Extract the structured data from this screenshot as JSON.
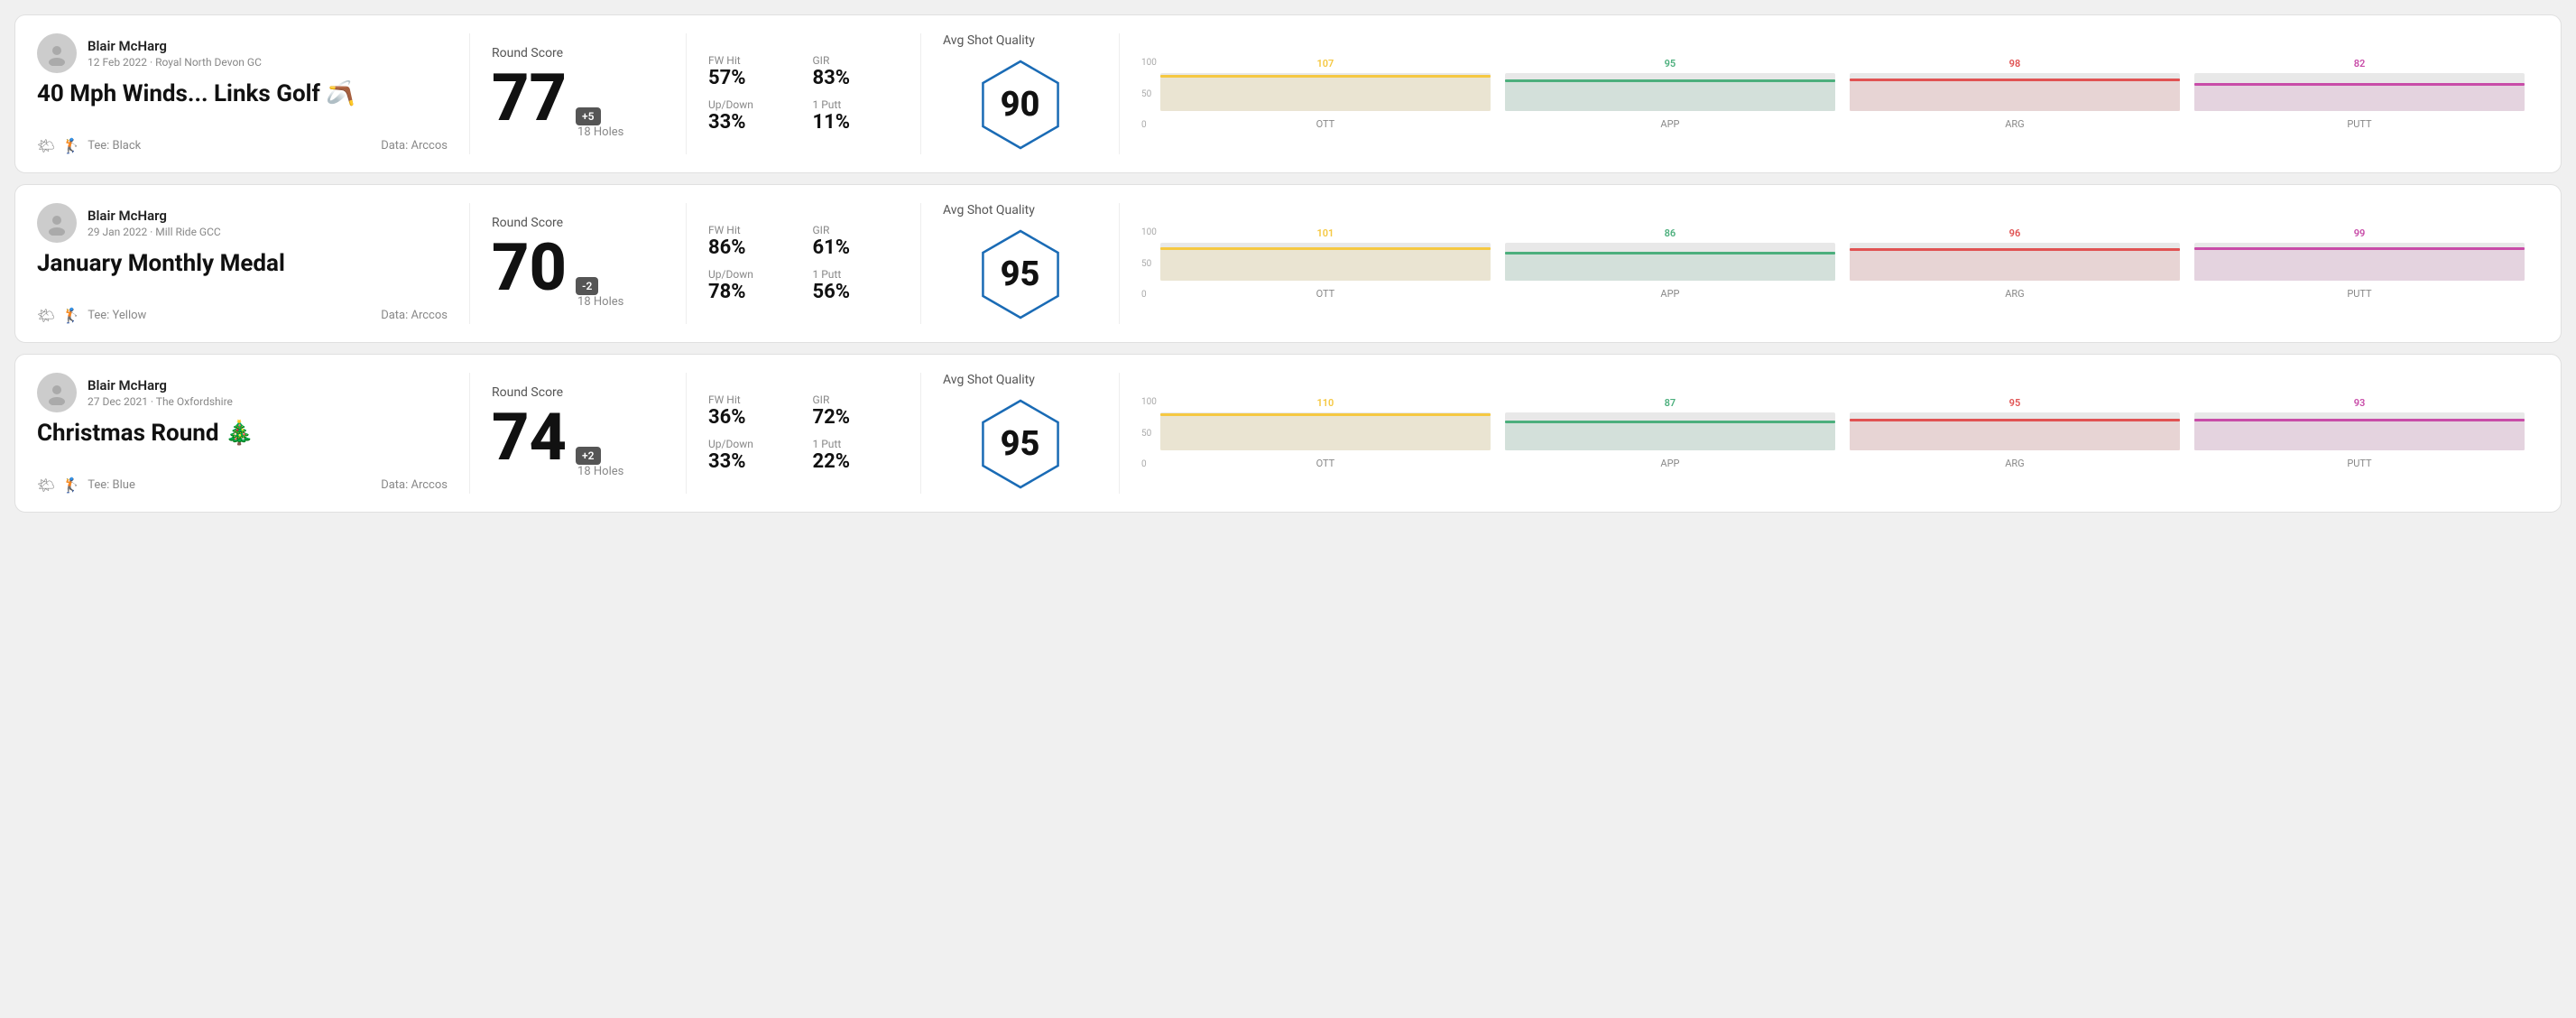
{
  "rounds": [
    {
      "id": "round1",
      "user": {
        "name": "Blair McHarg",
        "date": "12 Feb 2022",
        "course": "Royal North Devon GC"
      },
      "title": "40 Mph Winds... Links Golf 🪃",
      "tee": "Black",
      "data_source": "Arccos",
      "round_score_label": "Round Score",
      "score": "77",
      "score_diff": "+5",
      "holes": "18 Holes",
      "fw_hit_label": "FW Hit",
      "fw_hit": "57%",
      "gir_label": "GIR",
      "gir": "83%",
      "updown_label": "Up/Down",
      "updown": "33%",
      "one_putt_label": "1 Putt",
      "one_putt": "11%",
      "quality_label": "Avg Shot Quality",
      "quality_score": "90",
      "chart": {
        "bars": [
          {
            "label": "OTT",
            "value": 107,
            "color": "#f5c842"
          },
          {
            "label": "APP",
            "value": 95,
            "color": "#4caf7d"
          },
          {
            "label": "ARG",
            "value": 98,
            "color": "#e05252"
          },
          {
            "label": "PUTT",
            "value": 82,
            "color": "#c84ca8"
          }
        ],
        "max": 120
      }
    },
    {
      "id": "round2",
      "user": {
        "name": "Blair McHarg",
        "date": "29 Jan 2022",
        "course": "Mill Ride GCC"
      },
      "title": "January Monthly Medal",
      "tee": "Yellow",
      "data_source": "Arccos",
      "round_score_label": "Round Score",
      "score": "70",
      "score_diff": "-2",
      "holes": "18 Holes",
      "fw_hit_label": "FW Hit",
      "fw_hit": "86%",
      "gir_label": "GIR",
      "gir": "61%",
      "updown_label": "Up/Down",
      "updown": "78%",
      "one_putt_label": "1 Putt",
      "one_putt": "56%",
      "quality_label": "Avg Shot Quality",
      "quality_score": "95",
      "chart": {
        "bars": [
          {
            "label": "OTT",
            "value": 101,
            "color": "#f5c842"
          },
          {
            "label": "APP",
            "value": 86,
            "color": "#4caf7d"
          },
          {
            "label": "ARG",
            "value": 96,
            "color": "#e05252"
          },
          {
            "label": "PUTT",
            "value": 99,
            "color": "#c84ca8"
          }
        ],
        "max": 120
      }
    },
    {
      "id": "round3",
      "user": {
        "name": "Blair McHarg",
        "date": "27 Dec 2021",
        "course": "The Oxfordshire"
      },
      "title": "Christmas Round 🎄",
      "tee": "Blue",
      "data_source": "Arccos",
      "round_score_label": "Round Score",
      "score": "74",
      "score_diff": "+2",
      "holes": "18 Holes",
      "fw_hit_label": "FW Hit",
      "fw_hit": "36%",
      "gir_label": "GIR",
      "gir": "72%",
      "updown_label": "Up/Down",
      "updown": "33%",
      "one_putt_label": "1 Putt",
      "one_putt": "22%",
      "quality_label": "Avg Shot Quality",
      "quality_score": "95",
      "chart": {
        "bars": [
          {
            "label": "OTT",
            "value": 110,
            "color": "#f5c842"
          },
          {
            "label": "APP",
            "value": 87,
            "color": "#4caf7d"
          },
          {
            "label": "ARG",
            "value": 95,
            "color": "#e05252"
          },
          {
            "label": "PUTT",
            "value": 93,
            "color": "#c84ca8"
          }
        ],
        "max": 120
      }
    }
  ],
  "y_axis_labels": [
    "100",
    "50",
    "0"
  ]
}
